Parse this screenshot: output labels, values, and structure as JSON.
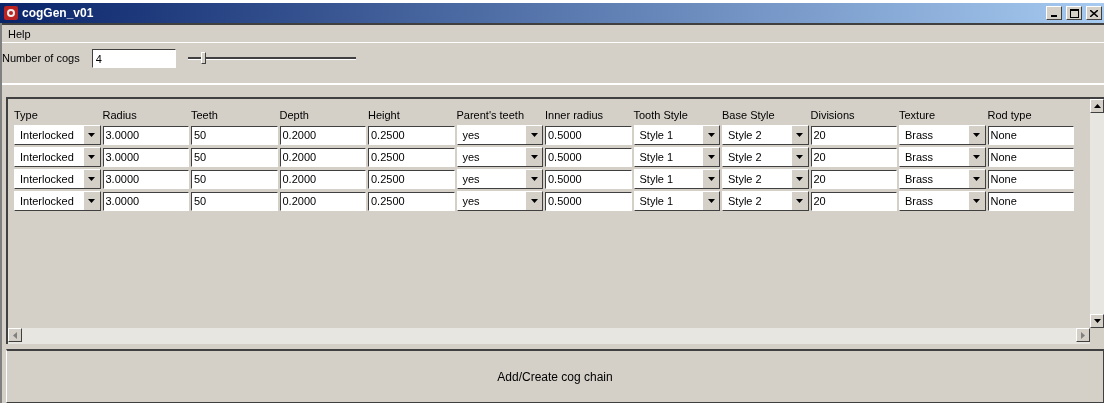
{
  "window": {
    "title": "cogGen_v01"
  },
  "menu": [
    "Help"
  ],
  "cog_count": {
    "label": "Number of cogs",
    "value": "4",
    "level": 0.08
  },
  "table": {
    "columns": [
      {
        "label": "Type",
        "kind": "dropdown"
      },
      {
        "label": "Radius",
        "kind": "text"
      },
      {
        "label": "Teeth",
        "kind": "text"
      },
      {
        "label": "Depth",
        "kind": "text"
      },
      {
        "label": "Height",
        "kind": "text"
      },
      {
        "label": "Parent's teeth",
        "kind": "dropdown"
      },
      {
        "label": "Inner radius",
        "kind": "text"
      },
      {
        "label": "Tooth Style",
        "kind": "dropdown"
      },
      {
        "label": "Base Style",
        "kind": "dropdown"
      },
      {
        "label": "Divisions",
        "kind": "text"
      },
      {
        "label": "Texture",
        "kind": "dropdown"
      },
      {
        "label": "Rod type",
        "kind": "text"
      }
    ],
    "rows": [
      [
        "Interlocked",
        "3.0000",
        "50",
        "0.2000",
        "0.2500",
        "yes",
        "0.5000",
        "Style 1",
        "Style 2",
        "20",
        "Brass",
        "None"
      ],
      [
        "Interlocked",
        "3.0000",
        "50",
        "0.2000",
        "0.2500",
        "yes",
        "0.5000",
        "Style 1",
        "Style 2",
        "20",
        "Brass",
        "None"
      ],
      [
        "Interlocked",
        "3.0000",
        "50",
        "0.2000",
        "0.2500",
        "yes",
        "0.5000",
        "Style 1",
        "Style 2",
        "20",
        "Brass",
        "None"
      ],
      [
        "Interlocked",
        "3.0000",
        "50",
        "0.2000",
        "0.2500",
        "yes",
        "0.5000",
        "Style 1",
        "Style 2",
        "20",
        "Brass",
        "None"
      ]
    ]
  },
  "action_button": "Add/Create cog chain"
}
